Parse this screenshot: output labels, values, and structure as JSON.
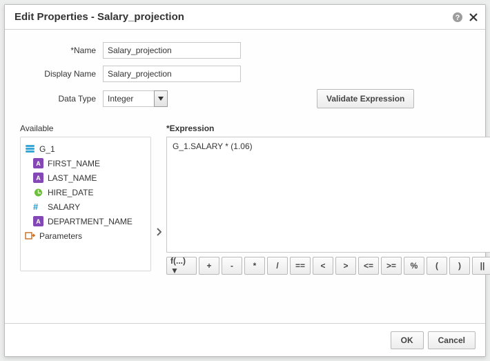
{
  "dialog": {
    "title": "Edit Properties - Salary_projection"
  },
  "form": {
    "name_label": "*Name",
    "name_value": "Salary_projection",
    "display_name_label": "Display Name",
    "display_name_value": "Salary_projection",
    "data_type_label": "Data Type",
    "data_type_value": "Integer",
    "validate_label": "Validate Expression"
  },
  "available": {
    "header": "Available",
    "tree": {
      "group": "G_1",
      "items": [
        {
          "kind": "abc",
          "label": "FIRST_NAME"
        },
        {
          "kind": "abc",
          "label": "LAST_NAME"
        },
        {
          "kind": "date",
          "label": "HIRE_DATE"
        },
        {
          "kind": "num",
          "label": "SALARY"
        },
        {
          "kind": "abc",
          "label": "DEPARTMENT_NAME"
        }
      ],
      "parameters_label": "Parameters"
    }
  },
  "expression": {
    "header": "*Expression",
    "value": "G_1.SALARY * (1.06)"
  },
  "operators": {
    "fx": "f(...) ▼",
    "list": [
      "+",
      "-",
      "*",
      "/",
      "==",
      "<",
      ">",
      "<=",
      ">=",
      "%",
      "(",
      ")",
      "||"
    ]
  },
  "footer": {
    "ok": "OK",
    "cancel": "Cancel"
  }
}
